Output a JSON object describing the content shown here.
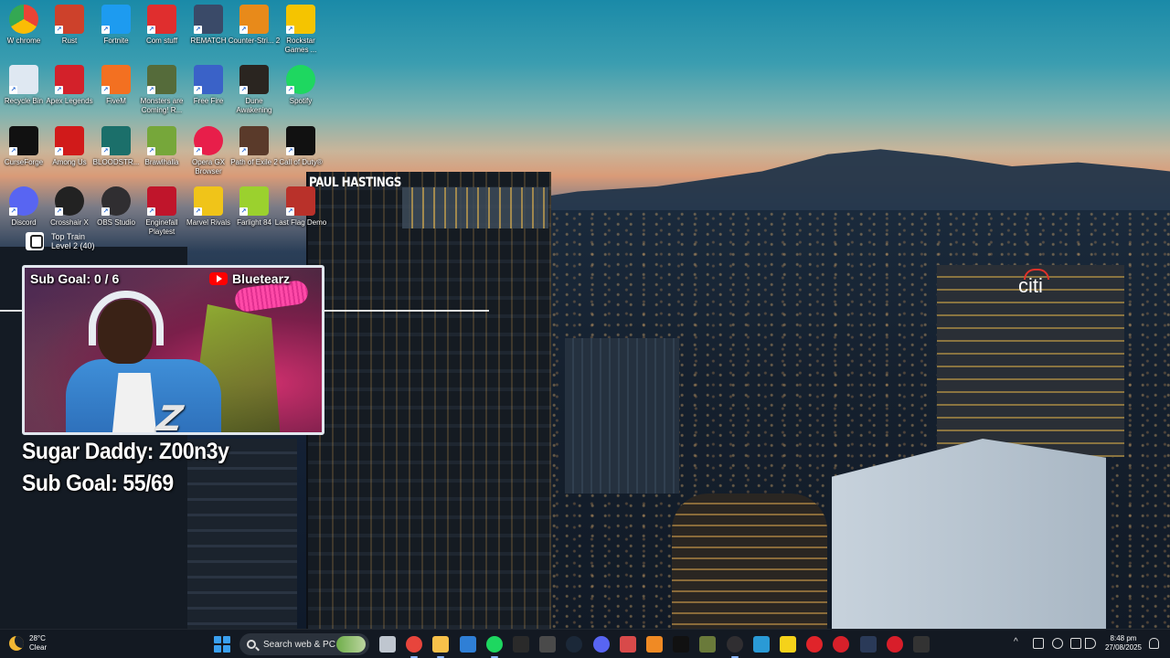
{
  "desktop_icons": [
    {
      "label": "W chrome",
      "icon": "chrome-icon",
      "color": "#ffffff"
    },
    {
      "label": "Rust",
      "icon": "rust-icon",
      "color": "#cd412b"
    },
    {
      "label": "Fortnite",
      "icon": "fortnite-icon",
      "color": "#1d9bf0"
    },
    {
      "label": "Com stuff",
      "icon": "power-icon",
      "color": "#e02e2e"
    },
    {
      "label": "REMATCH",
      "icon": "soccer-ball-icon",
      "color": "#3a4a68"
    },
    {
      "label": "Counter-Stri... 2",
      "icon": "counter-strike-icon",
      "color": "#e88a1a"
    },
    {
      "label": "Rockstar Games ...",
      "icon": "rockstar-icon",
      "color": "#f5c400"
    },
    {
      "label": "Recycle Bin",
      "icon": "recycle-bin-icon",
      "color": "#dfe8f2"
    },
    {
      "label": "Apex Legends",
      "icon": "apex-icon",
      "color": "#d3212a"
    },
    {
      "label": "FiveM",
      "icon": "fivem-icon",
      "color": "#f37021"
    },
    {
      "label": "Monsters are Coming! R...",
      "icon": "monsters-icon",
      "color": "#556b3a"
    },
    {
      "label": "Free Fire",
      "icon": "free-fire-icon",
      "color": "#3a62c8"
    },
    {
      "label": "Dune Awakening",
      "icon": "dune-icon",
      "color": "#2a2520"
    },
    {
      "label": "Spotify",
      "icon": "spotify-icon",
      "color": "#1ed760"
    },
    {
      "label": "CurseForge",
      "icon": "curseforge-icon",
      "color": "#111111"
    },
    {
      "label": "Among Us",
      "icon": "among-us-icon",
      "color": "#d11a1a"
    },
    {
      "label": "BLOODSTR...",
      "icon": "bloodstrike-icon",
      "color": "#1b6f6a"
    },
    {
      "label": "Brawlhalla",
      "icon": "brawlhalla-icon",
      "color": "#76a73a"
    },
    {
      "label": "Opera GX Browser",
      "icon": "opera-gx-icon",
      "color": "#e81e4a"
    },
    {
      "label": "Path of Exile 2",
      "icon": "poe-icon",
      "color": "#5a3a2a"
    },
    {
      "label": "Call of Duty®",
      "icon": "call-of-duty-icon",
      "color": "#111111"
    },
    {
      "label": "Discord",
      "icon": "discord-icon",
      "color": "#5865f2"
    },
    {
      "label": "Crosshair X",
      "icon": "crosshair-icon",
      "color": "#222222"
    },
    {
      "label": "OBS Studio",
      "icon": "obs-icon",
      "color": "#302e31"
    },
    {
      "label": "Enginefall Playtest",
      "icon": "enginefall-icon",
      "color": "#c0152b"
    },
    {
      "label": "Marvel Rivals",
      "icon": "marvel-rivals-icon",
      "color": "#f0c419"
    },
    {
      "label": "Farlight 84",
      "icon": "farlight-icon",
      "color": "#9bd12e"
    },
    {
      "label": "Last Flag Demo",
      "icon": "last-flag-icon",
      "color": "#b9312a"
    }
  ],
  "toptrain": {
    "line1": "Top Train",
    "line2": "Level 2  (40)"
  },
  "webcam": {
    "sub_goal": "Sub Goal: 0 / 6",
    "channel": "Bluetearz"
  },
  "overlay": {
    "line1": "Sugar Daddy: Z00n3y",
    "line2": "Sub Goal: 55/69"
  },
  "signs": {
    "building": "PAUL HASTINGS",
    "citi": "citi"
  },
  "taskbar": {
    "weather_temp": "28°C",
    "weather_cond": "Clear",
    "search_placeholder": "Search web & PC",
    "time": "8:48 pm",
    "date": "27/08/2025",
    "apps": [
      {
        "name": "task-view-icon",
        "color": "#bfc6cf"
      },
      {
        "name": "chrome-icon",
        "color": "#e8453c"
      },
      {
        "name": "file-explorer-icon",
        "color": "#f7c14a"
      },
      {
        "name": "visual-studio-icon",
        "color": "#2f7fd6"
      },
      {
        "name": "spotify-icon",
        "color": "#1ed760"
      },
      {
        "name": "epic-games-icon",
        "color": "#2a2a2a"
      },
      {
        "name": "app-icon",
        "color": "#4a4a4a"
      },
      {
        "name": "steam-icon",
        "color": "#1b2838"
      },
      {
        "name": "discord-icon",
        "color": "#5865f2"
      },
      {
        "name": "app-icon-2",
        "color": "#d84a4a"
      },
      {
        "name": "vlc-icon",
        "color": "#f08a24"
      },
      {
        "name": "capcut-icon",
        "color": "#111111"
      },
      {
        "name": "app-icon-3",
        "color": "#6a7a3a"
      },
      {
        "name": "obs-icon",
        "color": "#302e31"
      },
      {
        "name": "photos-icon",
        "color": "#2a9ad6"
      },
      {
        "name": "sticky-notes-icon",
        "color": "#f5d21a"
      },
      {
        "name": "app-icon-4",
        "color": "#e0242a"
      },
      {
        "name": "app-icon-5",
        "color": "#d8202a"
      },
      {
        "name": "fortnite-icon",
        "color": "#2a3a58"
      },
      {
        "name": "app-icon-6",
        "color": "#d81e2a"
      },
      {
        "name": "app-icon-7",
        "color": "#333333"
      }
    ]
  }
}
